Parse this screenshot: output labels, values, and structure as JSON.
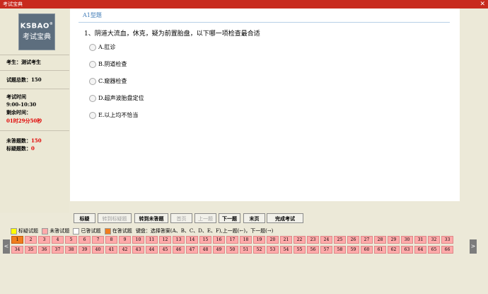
{
  "window": {
    "title": "考试宝典",
    "close_glyph": "✕"
  },
  "logo": {
    "brand": "KSBAO",
    "reg": "®",
    "subtitle": "考试宝典"
  },
  "info": {
    "examinee": "考生：测试考生",
    "total": "试题总数：150",
    "time_label": "考试时间",
    "time_value": "9:00-10:30",
    "remaining_label": "剩余时间：",
    "remaining_value": "01时29分50秒",
    "unanswered_label": "未答题数：",
    "unanswered_value": "150",
    "marked_label": "标疑题数：",
    "marked_value": "0"
  },
  "question": {
    "type": "A1型题",
    "text": "1、阴道大流血，休克，疑为前置胎盘，以下哪一项检查最合适",
    "options": [
      "A.肛诊",
      "B.阴道检查",
      "C.窥器检查",
      "D.超声波胎盘定位",
      "E.以上均不恰当"
    ]
  },
  "buttons": [
    "标疑",
    "转到标疑题",
    "转到未答题",
    "首页",
    "上一题",
    "下一题",
    "末页",
    "完成考试"
  ],
  "legend": {
    "marked": "标疑试题",
    "unanswered": "未答试题",
    "answered": "已答试题",
    "current": "在答试题",
    "hint": "键盘：选择答案(A、B、C、D、E、F),上一题(←)，下一题(→)"
  },
  "nav": {
    "left": "<",
    "right": ">"
  },
  "colors": {
    "titlebar": "#c82a1e",
    "unanswered": "#ffaaaa",
    "current": "#f07d1e",
    "marked": "#ffff00",
    "accent": "#3b78b5"
  }
}
